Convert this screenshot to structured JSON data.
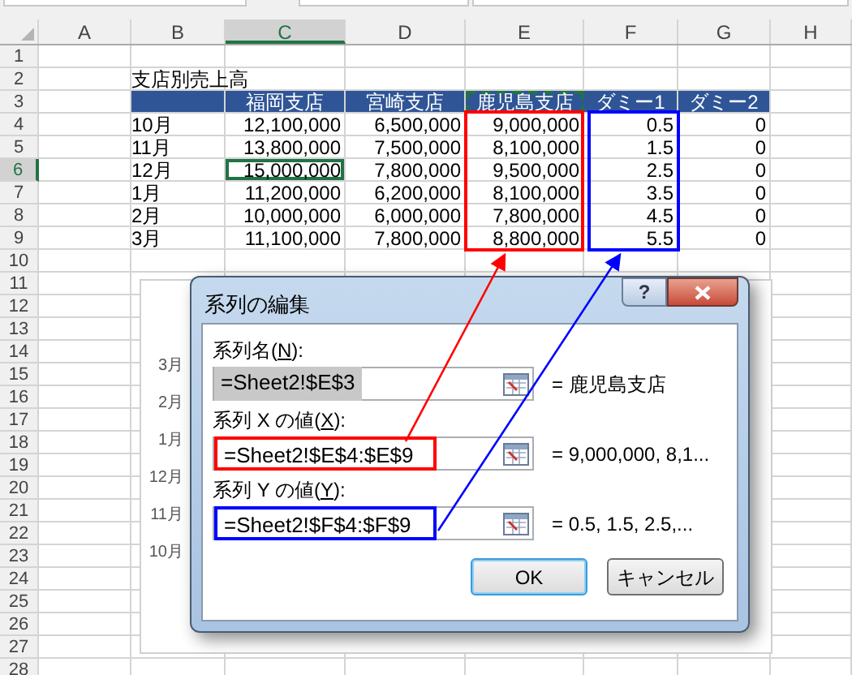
{
  "columns": [
    {
      "label": "A",
      "selected": false
    },
    {
      "label": "B",
      "selected": false
    },
    {
      "label": "C",
      "selected": true
    },
    {
      "label": "D",
      "selected": false
    },
    {
      "label": "E",
      "selected": false
    },
    {
      "label": "F",
      "selected": false
    },
    {
      "label": "G",
      "selected": false
    },
    {
      "label": "H",
      "selected": false
    }
  ],
  "row_headers": [
    {
      "label": "1",
      "selected": false
    },
    {
      "label": "2",
      "selected": false
    },
    {
      "label": "3",
      "selected": false
    },
    {
      "label": "4",
      "selected": false
    },
    {
      "label": "5",
      "selected": false
    },
    {
      "label": "6",
      "selected": true
    },
    {
      "label": "7",
      "selected": false
    },
    {
      "label": "8",
      "selected": false
    },
    {
      "label": "9",
      "selected": false
    },
    {
      "label": "10",
      "selected": false
    },
    {
      "label": "11",
      "selected": false
    },
    {
      "label": "12",
      "selected": false
    },
    {
      "label": "13",
      "selected": false
    },
    {
      "label": "14",
      "selected": false
    },
    {
      "label": "15",
      "selected": false
    },
    {
      "label": "16",
      "selected": false
    },
    {
      "label": "17",
      "selected": false
    },
    {
      "label": "18",
      "selected": false
    },
    {
      "label": "19",
      "selected": false
    },
    {
      "label": "20",
      "selected": false
    },
    {
      "label": "21",
      "selected": false
    },
    {
      "label": "22",
      "selected": false
    },
    {
      "label": "23",
      "selected": false
    },
    {
      "label": "24",
      "selected": false
    },
    {
      "label": "25",
      "selected": false
    },
    {
      "label": "26",
      "selected": false
    },
    {
      "label": "27",
      "selected": false
    },
    {
      "label": "28",
      "selected": false
    }
  ],
  "sheet_title": "支店別売上高",
  "table_header": [
    {
      "text": "福岡支店",
      "marked": false
    },
    {
      "text": "宮崎支店",
      "marked": false
    },
    {
      "text": "鹿児島支店",
      "marked": true
    },
    {
      "text": "ダミー1",
      "marked": false
    },
    {
      "text": "ダミー2",
      "marked": false
    }
  ],
  "table_rows": [
    {
      "cells": [
        {
          "text": "10月",
          "selected": false
        },
        {
          "text": "12,100,000",
          "selected": false
        },
        {
          "text": "6,500,000",
          "selected": false
        },
        {
          "text": "9,000,000",
          "selected": false
        },
        {
          "text": "0.5",
          "selected": false
        },
        {
          "text": "0",
          "selected": false
        }
      ]
    },
    {
      "cells": [
        {
          "text": "11月",
          "selected": false
        },
        {
          "text": "13,800,000",
          "selected": false
        },
        {
          "text": "7,500,000",
          "selected": false
        },
        {
          "text": "8,100,000",
          "selected": false
        },
        {
          "text": "1.5",
          "selected": false
        },
        {
          "text": "0",
          "selected": false
        }
      ]
    },
    {
      "cells": [
        {
          "text": "12月",
          "selected": false
        },
        {
          "text": "15,000,000",
          "selected": true
        },
        {
          "text": "7,800,000",
          "selected": false
        },
        {
          "text": "9,500,000",
          "selected": false
        },
        {
          "text": "2.5",
          "selected": false
        },
        {
          "text": "0",
          "selected": false
        }
      ]
    },
    {
      "cells": [
        {
          "text": "1月",
          "selected": false
        },
        {
          "text": "11,200,000",
          "selected": false
        },
        {
          "text": "6,200,000",
          "selected": false
        },
        {
          "text": "8,100,000",
          "selected": false
        },
        {
          "text": "3.5",
          "selected": false
        },
        {
          "text": "0",
          "selected": false
        }
      ]
    },
    {
      "cells": [
        {
          "text": "2月",
          "selected": false
        },
        {
          "text": "10,000,000",
          "selected": false
        },
        {
          "text": "6,000,000",
          "selected": false
        },
        {
          "text": "7,800,000",
          "selected": false
        },
        {
          "text": "4.5",
          "selected": false
        },
        {
          "text": "0",
          "selected": false
        }
      ]
    },
    {
      "cells": [
        {
          "text": "3月",
          "selected": false
        },
        {
          "text": "11,100,000",
          "selected": false
        },
        {
          "text": "7,800,000",
          "selected": false
        },
        {
          "text": "8,800,000",
          "selected": false
        },
        {
          "text": "5.5",
          "selected": false
        },
        {
          "text": "0",
          "selected": false
        }
      ]
    }
  ],
  "chart_axis_labels": [
    "3月",
    "2月",
    "1月",
    "12月",
    "11月",
    "10月"
  ],
  "annotations": [
    {
      "color": "#ff0000"
    },
    {
      "color": "#0000ff"
    }
  ],
  "dialog": {
    "title": "系列の編集",
    "help": "?",
    "fields": [
      {
        "label": "系列名(",
        "key": "N",
        "suffix": "):",
        "value": "=Sheet2!$E$3",
        "text_selected": true,
        "preview": "= 鹿児島支店"
      },
      {
        "label": "系列 X の値(",
        "key": "X",
        "suffix": "):",
        "value": "=Sheet2!$E$4:$E$9",
        "text_selected": false,
        "color": "#ff0000",
        "preview": "= 9,000,000, 8,1..."
      },
      {
        "label": "系列 Y の値(",
        "key": "Y",
        "suffix": "):",
        "value": "=Sheet2!$F$4:$F$9",
        "text_selected": false,
        "color": "#0000ff",
        "preview": "= 0.5, 1.5, 2.5,..."
      }
    ],
    "buttons": [
      {
        "label": "OK",
        "default": true
      },
      {
        "label": "キャンセル",
        "default": false
      }
    ]
  }
}
